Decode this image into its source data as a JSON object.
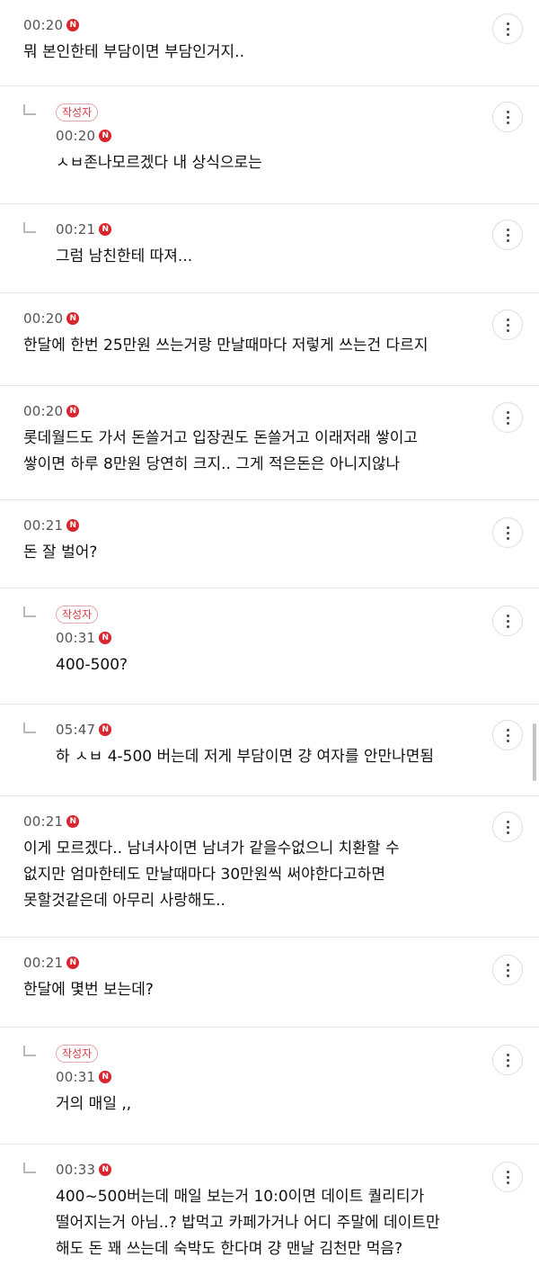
{
  "comments": [
    {
      "reply": false,
      "author": false,
      "time": "00:20",
      "n": "N",
      "text": "뭐 본인한테 부담이면 부담인거지.."
    },
    {
      "reply": true,
      "author": true,
      "time": "00:20",
      "n": "N",
      "text": "ㅅㅂ존나모르겠다 내 상식으로는"
    },
    {
      "reply": true,
      "author": false,
      "time": "00:21",
      "n": "N",
      "text": "그럼 남친한테 따져..."
    },
    {
      "reply": false,
      "author": false,
      "time": "00:20",
      "n": "N",
      "text": "한달에 한번 25만원 쓰는거랑 만날때마다 저렇게 쓰는건 다르지"
    },
    {
      "reply": false,
      "author": false,
      "time": "00:20",
      "n": "N",
      "text": "롯데월드도 가서 돈쓸거고 입장권도 돈쓸거고 이래저래 쌓이고\n쌓이면 하루 8만원 당연히 크지.. 그게 적은돈은 아니지않나"
    },
    {
      "reply": false,
      "author": false,
      "time": "00:21",
      "n": "N",
      "text": "돈 잘 벌어?"
    },
    {
      "reply": true,
      "author": true,
      "time": "00:31",
      "n": "N",
      "text": "400-500?"
    },
    {
      "reply": true,
      "author": false,
      "time": "05:47",
      "n": "N",
      "text": "하 ㅅㅂ 4-500 버는데 저게 부담이면 걍 여자를 안만나면됨"
    },
    {
      "reply": false,
      "author": false,
      "time": "00:21",
      "n": "N",
      "text": "이게 모르겠다.. 남녀사이면 남녀가 같을수없으니 치환할 수\n없지만 엄마한테도 만날때마다 30만원씩 써야한다고하면\n못할것같은데 아무리 사랑해도.."
    },
    {
      "reply": false,
      "author": false,
      "time": "00:21",
      "n": "N",
      "text": "한달에 몇번 보는데?"
    },
    {
      "reply": true,
      "author": true,
      "time": "00:31",
      "n": "N",
      "text": "거의 매일 ,,"
    },
    {
      "reply": true,
      "author": false,
      "time": "00:33",
      "n": "N",
      "text": "400~500버는데 매일 보는거 10:0이면 데이트 퀄리티가\n떨어지는거 아님..? 밥먹고 카페가거나 어디 주말에 데이트만\n해도 돈 꽤 쓰는데 숙박도 한다며 걍 맨날 김천만 먹음?"
    }
  ],
  "author_badge": "작성자"
}
